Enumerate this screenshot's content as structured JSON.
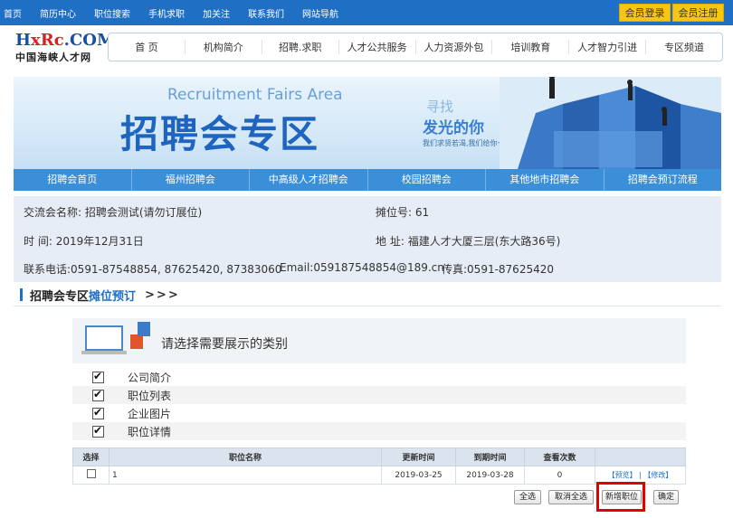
{
  "topbar": {
    "links": [
      "首页",
      "简历中心",
      "职位搜索",
      "手机求职",
      "加关注",
      "联系我们",
      "网站导航"
    ],
    "member_login": "会员登录",
    "member_register": "会员注册"
  },
  "logo": {
    "mark_a": "H",
    "mark_b": "xRc",
    "mark_c": ".COM",
    "sub": "中国海峡人才网"
  },
  "nav": [
    "首 页",
    "机构简介",
    "招聘.求职",
    "人才公共服务",
    "人力资源外包",
    "培训教育",
    "人才智力引进",
    "专区频道"
  ],
  "banner": {
    "en": "Recruitment Fairs Area",
    "cn": "招聘会专区",
    "seek": "寻找",
    "light": "发光的你",
    "small": "我们求贤若渴,我们给你一个舞台"
  },
  "subtabs": [
    "招聘会首页",
    "福州招聘会",
    "中高级人才招聘会",
    "校园招聘会",
    "其他地市招聘会",
    "招聘会预订流程"
  ],
  "info": {
    "fair_name_label": "交流会名称:",
    "fair_name": "招聘会测试(请勿订展位)",
    "booth_label": "摊位号:",
    "booth": "61",
    "time_label": "时 间:",
    "time": "2019年12月31日",
    "address_label": "地 址:",
    "address": "福建人才大厦三层(东大路36号)",
    "phone_label": "联系电话:",
    "phone": "0591-87548854, 87625420, 87383060",
    "email_label": "Email:",
    "email": "059187548854@189.cn",
    "fax_label": "传真:",
    "fax": "0591-87625420"
  },
  "section": {
    "title": "招聘会专区",
    "title_link": "摊位预订",
    "arrows": ">>>"
  },
  "choose": {
    "title": "请选择需要展示的类别"
  },
  "options": [
    "公司简介",
    "职位列表",
    "企业图片",
    "职位详情"
  ],
  "table": {
    "headers": [
      "选择",
      "职位名称",
      "更新时间",
      "到期时间",
      "查看次数",
      ""
    ],
    "rows": [
      {
        "name": "1",
        "updated": "2019-03-25",
        "expires": "2019-03-28",
        "views": "0",
        "preview": "【预览】",
        "sep": "|",
        "edit": "【修改】"
      }
    ]
  },
  "buttons": {
    "select_all": "全选",
    "cancel_all": "取消全选",
    "new_job": "新增职位",
    "confirm": "确定"
  },
  "colors": {
    "primary": "#1f6fc4",
    "highlight": "#e00000",
    "gold": "#f7c514"
  }
}
